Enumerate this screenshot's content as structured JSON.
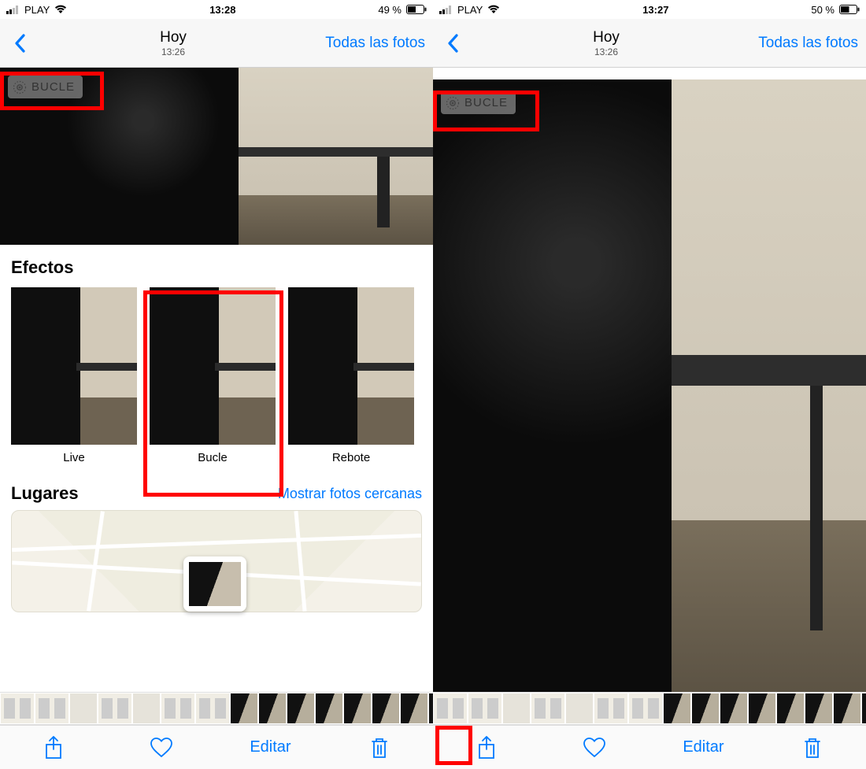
{
  "left": {
    "status": {
      "carrier": "PLAY",
      "time": "13:28",
      "battery": "49 %"
    },
    "nav": {
      "title": "Hoy",
      "subtitle": "13:26",
      "allPhotos": "Todas las fotos"
    },
    "badge": "BUCLE",
    "effects": {
      "heading": "Efectos",
      "items": [
        {
          "label": "Live",
          "selected": false
        },
        {
          "label": "Bucle",
          "selected": true
        },
        {
          "label": "Rebote",
          "selected": false
        }
      ]
    },
    "places": {
      "heading": "Lugares",
      "link": "Mostrar fotos cercanas"
    },
    "toolbar": {
      "edit": "Editar"
    }
  },
  "right": {
    "status": {
      "carrier": "PLAY",
      "time": "13:27",
      "battery": "50 %"
    },
    "nav": {
      "title": "Hoy",
      "subtitle": "13:26",
      "allPhotos": "Todas las fotos"
    },
    "badge": "BUCLE",
    "toolbar": {
      "edit": "Editar"
    }
  }
}
